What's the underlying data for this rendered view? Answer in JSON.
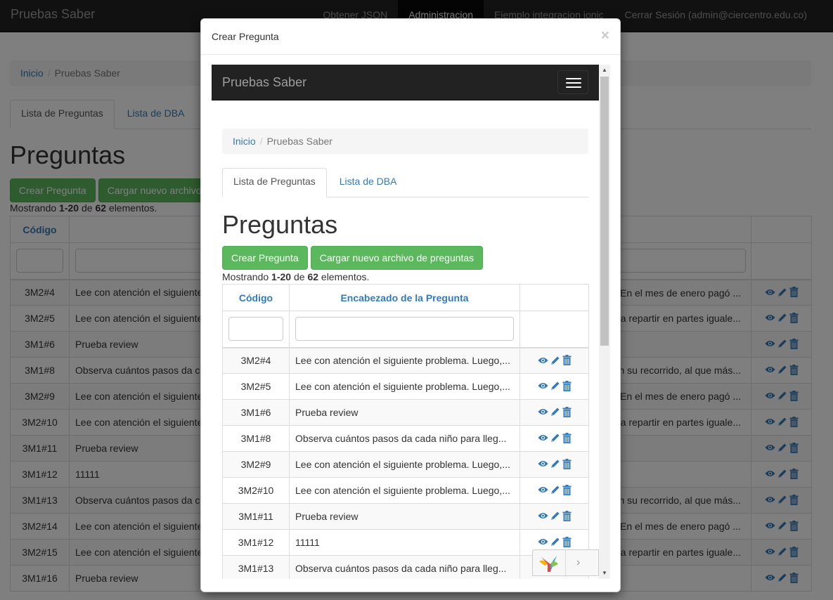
{
  "app": {
    "brand": "Pruebas Saber",
    "nav": [
      "Obtener JSON",
      "Administracion",
      "Ejemplo integracion ionic",
      "Cerrar Sesión (admin@ciercentro.edu.co)"
    ]
  },
  "breadcrumb": {
    "home": "Inicio",
    "current": "Pruebas Saber"
  },
  "tabs": [
    "Lista de Preguntas",
    "Lista de DBA"
  ],
  "page_title": "Preguntas",
  "buttons": {
    "create": "Crear Pregunta",
    "upload": "Cargar nuevo archivo de preguntas",
    "upload_truncated": "Cargar nuevo archivo"
  },
  "summary": {
    "prefix": "Mostrando ",
    "range": "1-20",
    "mid": " de ",
    "total": "62",
    "suffix": " elementos."
  },
  "table": {
    "headers": {
      "code": "Código",
      "heading": "Encabezado de la Pregunta"
    },
    "rows": [
      {
        "code": "3M2#4",
        "text": "Lee con atención el siguiente problema. Luego,...",
        "bg_left": "Lee con atención el siguiente",
        "bg_right": "En el mes de enero pagó ..."
      },
      {
        "code": "3M2#5",
        "text": "Lee con atención el siguiente problema. Luego,...",
        "bg_left": "Lee con atención el siguiente",
        "bg_right": "a repartir en partes iguale..."
      },
      {
        "code": "3M1#6",
        "text": "Prueba review",
        "bg_left": "Prueba review",
        "bg_right": ""
      },
      {
        "code": "3M1#8",
        "text": "Observa cuántos pasos da cada niño para lleg...",
        "bg_left": "Observa cuántos pasos da c",
        "bg_right": "n su recorrido, al que más..."
      },
      {
        "code": "3M2#9",
        "text": "Lee con atención el siguiente problema. Luego,...",
        "bg_left": "Lee con atención el siguiente",
        "bg_right": "En el mes de enero pagó ..."
      },
      {
        "code": "3M2#10",
        "text": "Lee con atención el siguiente problema. Luego,...",
        "bg_left": "Lee con atención el siguiente",
        "bg_right": "a repartir en partes iguale..."
      },
      {
        "code": "3M1#11",
        "text": "Prueba review",
        "bg_left": "Prueba review",
        "bg_right": ""
      },
      {
        "code": "3M1#12",
        "text": "11111",
        "bg_left": "11111",
        "bg_right": ""
      },
      {
        "code": "3M1#13",
        "text": "Observa cuántos pasos da cada niño para lleg...",
        "bg_left": "Observa cuántos pasos da c",
        "bg_right": "n su recorrido, al que más..."
      },
      {
        "code": "3M2#14",
        "text": "",
        "bg_left": "Lee con atención el siguiente",
        "bg_right": "En el mes de enero pagó ..."
      },
      {
        "code": "3M2#15",
        "text": "",
        "bg_left": "Lee con atención el siguiente",
        "bg_right": "a repartir en partes iguale..."
      },
      {
        "code": "3M1#16",
        "text": "",
        "bg_left": "Prueba review",
        "bg_right": ""
      }
    ]
  },
  "modal": {
    "title": "Crear Pregunta",
    "close": "×"
  },
  "icons": [
    "eye-icon",
    "pencil-icon",
    "trash-icon",
    "close-icon",
    "hamburger-icon",
    "yii-logo-icon",
    "chevron-right-icon"
  ],
  "colors": {
    "navbar": "#222222",
    "link": "#337ab7",
    "success": "#5cb85c",
    "backdrop": "rgba(0,0,0,0.5)"
  }
}
